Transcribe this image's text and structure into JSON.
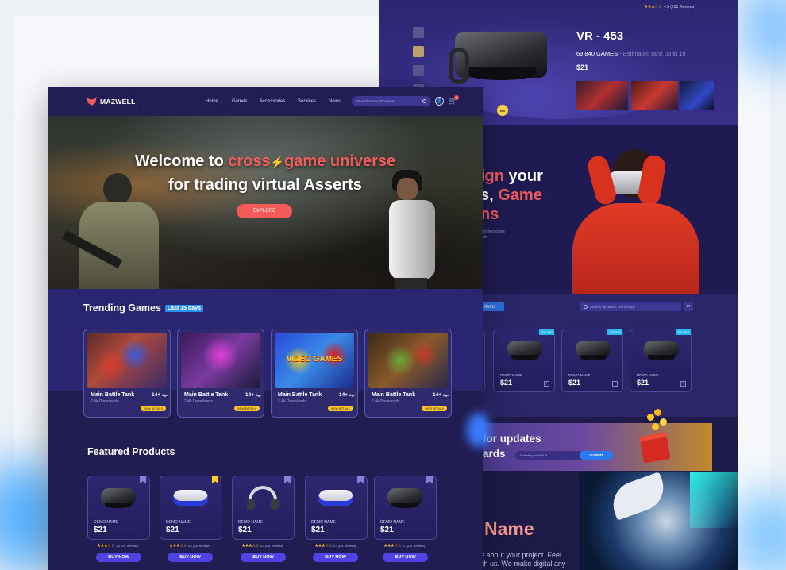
{
  "back": {
    "rating_text": "4.3 (231 Reviews)",
    "product_title": "VR - 453",
    "games_count": "69,840 GAMES",
    "rank_text": "- Estimated rank up in 1h",
    "price": "$21",
    "dial_badge": "960",
    "hero_line1": "ign your",
    "hero_line2_a": "s, ",
    "hero_line2_b": "Game",
    "hero_line3": "ns",
    "hero_sub1": "t technologies",
    "hero_sub2": "rom.",
    "items_label": "0 items",
    "search_placeholder": "Search by name, technology",
    "cards": [
      {
        "badge": "ONLINE",
        "name": "DEMO NAME",
        "price": "$21"
      },
      {
        "badge": "ONLINE",
        "name": "DEMO NAME",
        "price": "$21"
      },
      {
        "badge": "ONLINE",
        "name": "DEMO NAME",
        "price": "$21"
      }
    ],
    "updates_title": "for updates",
    "updates_sub": "ards",
    "email_placeholder": "Submit your Mail id",
    "submit_label": "SUBMIT",
    "name_title": "Name",
    "about1": "e about your project. Feel",
    "about2": "ch us. We make digital any"
  },
  "front": {
    "brand": "MAZWELL",
    "nav": [
      "Home",
      "Games",
      "Accessories",
      "Services",
      "News"
    ],
    "search_placeholder": "Search Game, Products",
    "cart_count": "1",
    "hero_welcome": "Welcome to ",
    "hero_cross": "cross",
    "hero_bolt": "⚡",
    "hero_universe": "game universe",
    "hero_line2": "for trading virtual Asserts",
    "explore_label": "EXPLORE",
    "trending_title": "Trending Games",
    "trending_badge": "Last 15 days",
    "games": [
      {
        "name": "Main Battle Tank",
        "age": "14+",
        "age_unit": "Age",
        "downloads": "2.4k Downloads",
        "button": "VIEW DETAILS"
      },
      {
        "name": "Main Battle Tank",
        "age": "14+",
        "age_unit": "Age",
        "downloads": "2.4k Downloads",
        "button": "VIEW DETAILS"
      },
      {
        "name": "Main Battle Tank",
        "age": "14+",
        "age_unit": "Age",
        "downloads": "2.4k Downloads",
        "button": "VIEW DETAILS",
        "art_text": "VIDEO GAMES"
      },
      {
        "name": "Main Battle Tank",
        "age": "14+",
        "age_unit": "Age",
        "downloads": "2.4k Downloads",
        "button": "VIEW DETAILS"
      }
    ],
    "featured_title": "Featured Products",
    "products": [
      {
        "name": "DEMO NAME",
        "price": "$21",
        "stars": "★★★☆☆",
        "reviews": "4.3 (231 Reviews)",
        "buy": "BUY NOW",
        "bookmark": "#8a7fd8"
      },
      {
        "name": "DEMO NAME",
        "price": "$21",
        "stars": "★★★☆☆",
        "reviews": "4.3 (231 Reviews)",
        "buy": "BUY NOW",
        "bookmark": "#ffd21f"
      },
      {
        "name": "DEMO NAME",
        "price": "$21",
        "stars": "★★★☆☆",
        "reviews": "4.3 (231 Reviews)",
        "buy": "BUY NOW",
        "bookmark": "#8a7fd8"
      },
      {
        "name": "DEMO NAME",
        "price": "$21",
        "stars": "★★★☆☆",
        "reviews": "4.3 (231 Reviews)",
        "buy": "BUY NOW",
        "bookmark": "#8a7fd8"
      },
      {
        "name": "DEMO NAME",
        "price": "$21",
        "stars": "★★★☆☆",
        "reviews": "4.3 (231 Reviews)",
        "buy": "BUY NOW",
        "bookmark": "#8a7fd8"
      }
    ]
  },
  "colors": {
    "accent_red": "#f35b5b",
    "accent_blue": "#2bb5f0",
    "button_yellow": "#ffc629",
    "button_purple": "#4f44e3",
    "bg_dark": "#211c52"
  }
}
